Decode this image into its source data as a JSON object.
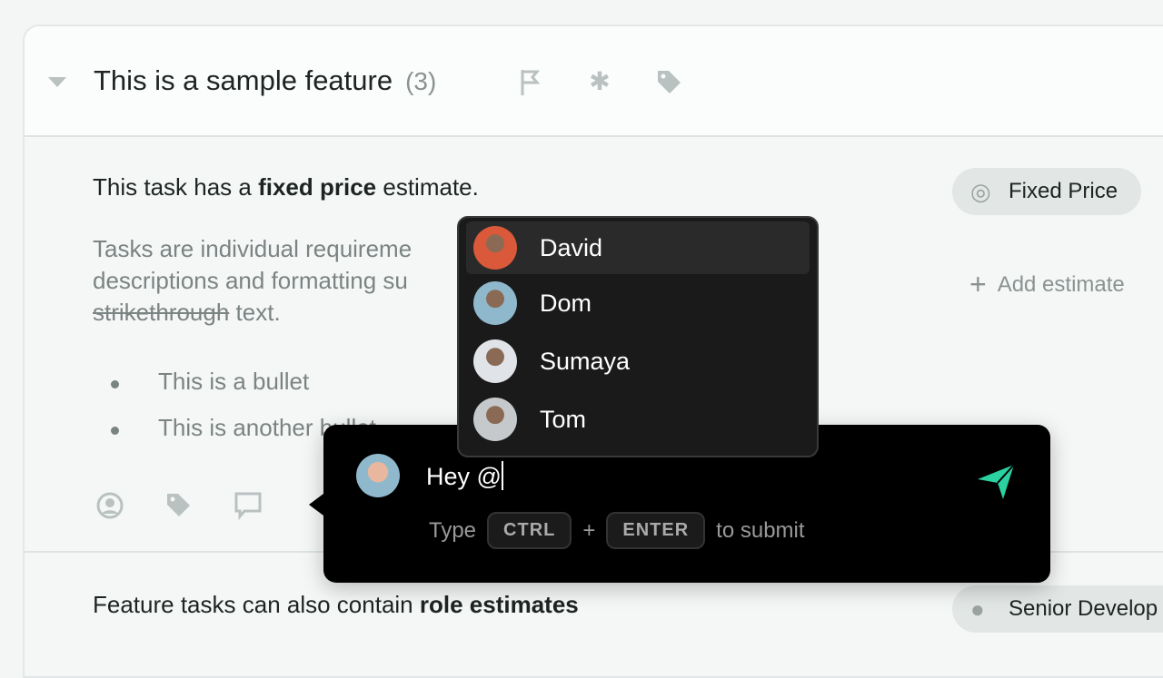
{
  "feature": {
    "title": "This is a sample feature",
    "count": "(3)",
    "icons": [
      "flag-icon",
      "asterisk-icon",
      "tag-icon"
    ]
  },
  "task1": {
    "prefix": "This task has a ",
    "bold": "fixed price",
    "suffix": " estimate.",
    "desc_line1": "Tasks are individual requireme",
    "desc_line2": "descriptions and formatting su",
    "desc_strike": "strikethrough",
    "desc_end": " text.",
    "bullets": [
      "This is a bullet",
      "This is another bullet"
    ],
    "estimate_badge": "Fixed Price",
    "add_estimate": "Add estimate"
  },
  "task2": {
    "prefix": "Feature tasks can also contain ",
    "bold": "role estimates",
    "role_badge": "Senior Develop"
  },
  "mention_dropdown": {
    "items": [
      {
        "name": "David",
        "color": "#d9593a",
        "selected": true
      },
      {
        "name": "Dom",
        "color": "#8fb8cc",
        "selected": false
      },
      {
        "name": "Sumaya",
        "color": "#e0e4e8",
        "selected": false
      },
      {
        "name": "Tom",
        "color": "#c6c9cc",
        "selected": false
      }
    ]
  },
  "comment": {
    "text": "Hey @",
    "hint_type": "Type",
    "key1": "CTRL",
    "plus": "+",
    "key2": "ENTER",
    "hint_end": "to submit",
    "send_color": "#2bd1a0"
  }
}
